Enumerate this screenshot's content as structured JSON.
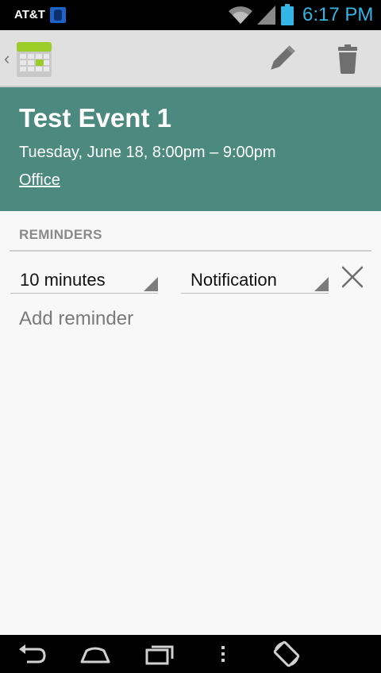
{
  "status_bar": {
    "carrier": "AT&T",
    "time": "6:17 PM",
    "icons": [
      "sim-icon",
      "wifi-icon",
      "signal-icon",
      "battery-icon"
    ],
    "time_color": "#33b5e5"
  },
  "action_bar": {
    "app_icon": "calendar-icon",
    "up_indicator": "‹",
    "actions": [
      "edit-pencil-icon",
      "trash-icon"
    ]
  },
  "event": {
    "title": "Test Event 1",
    "when": "Tuesday, June 18, 8:00pm – 9:00pm",
    "where": "Office",
    "header_color": "#4c8a7f"
  },
  "reminders": {
    "header": "REMINDERS",
    "items": [
      {
        "time": "10 minutes",
        "method": "Notification"
      }
    ],
    "add_label": "Add reminder"
  },
  "nav_bar": {
    "buttons": [
      "back-icon",
      "home-icon",
      "recents-icon",
      "menu-icon",
      "rotate-icon"
    ]
  }
}
